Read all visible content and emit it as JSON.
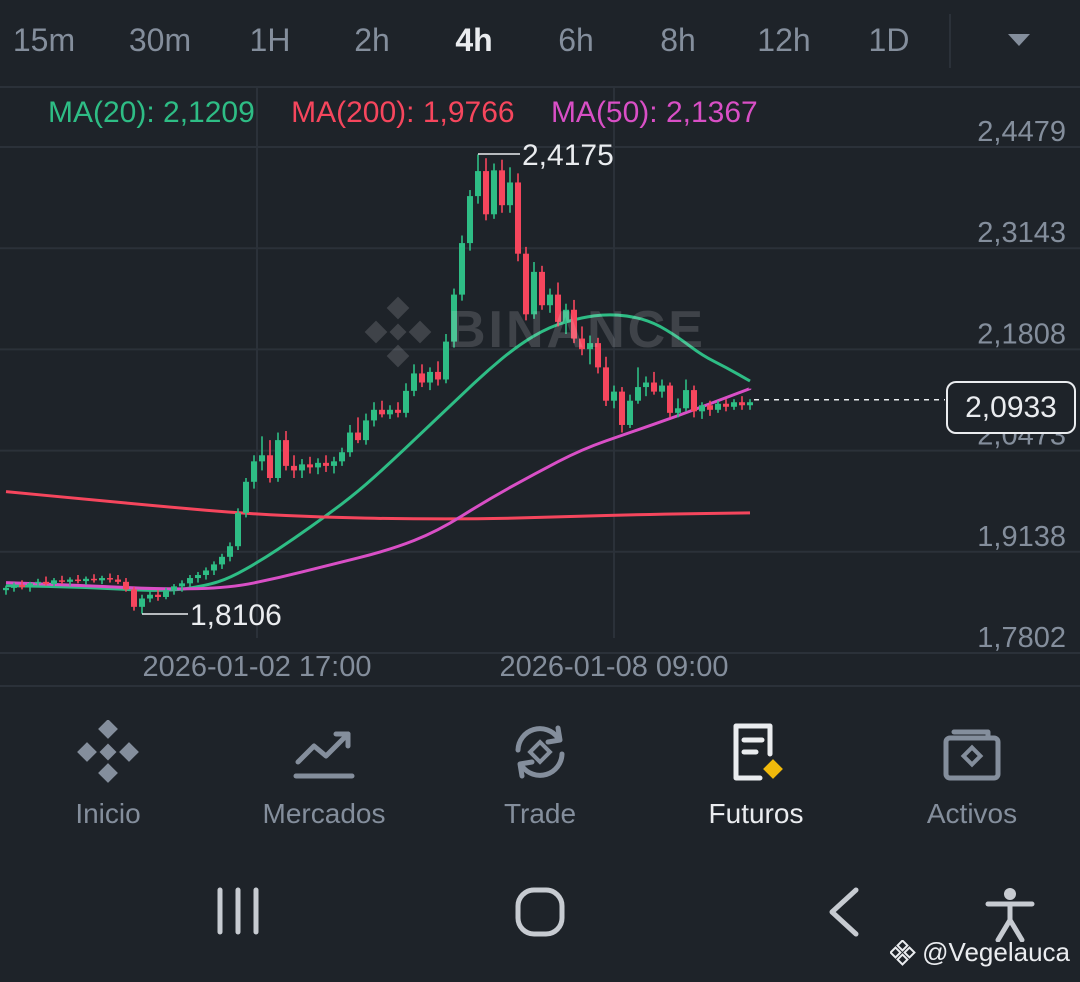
{
  "timeframes": {
    "items": [
      "15m",
      "30m",
      "1H",
      "2h",
      "4h",
      "6h",
      "8h",
      "12h",
      "1D"
    ],
    "active": "4h"
  },
  "ma_legend": [
    {
      "label": "MA(20): 2,1209",
      "color": "#2ebd85"
    },
    {
      "label": "MA(200): 1,9766",
      "color": "#f6465d"
    },
    {
      "label": "MA(50): 2,1367",
      "color": "#d94fc6"
    }
  ],
  "watermark": "BINANCE",
  "chart_data": {
    "type": "candlestick",
    "y_ticks": [
      "2,4479",
      "2,3143",
      "2,1808",
      "2,0473",
      "1,9138",
      "1,7802"
    ],
    "y_tick_values": [
      2.4479,
      2.3143,
      2.1808,
      2.0473,
      1.9138,
      1.7802
    ],
    "x_ticks": [
      "2026-01-02 17:00",
      "2026-01-08 09:00"
    ],
    "ylim": [
      1.7802,
      2.4479
    ],
    "current_price": "2,0933",
    "current_price_value": 2.0933,
    "high_label": "2,4175",
    "high_value": 2.4175,
    "low_label": "1,8106",
    "low_value": 1.8106,
    "up_color": "#2ebd85",
    "down_color": "#f6465d",
    "candles": [
      [
        1.842,
        1.848,
        1.836,
        1.845
      ],
      [
        1.845,
        1.852,
        1.84,
        1.849
      ],
      [
        1.849,
        1.855,
        1.843,
        1.846
      ],
      [
        1.846,
        1.853,
        1.84,
        1.851
      ],
      [
        1.851,
        1.857,
        1.846,
        1.853
      ],
      [
        1.853,
        1.86,
        1.848,
        1.85
      ],
      [
        1.85,
        1.858,
        1.845,
        1.855
      ],
      [
        1.855,
        1.861,
        1.85,
        1.853
      ],
      [
        1.853,
        1.859,
        1.848,
        1.856
      ],
      [
        1.856,
        1.862,
        1.851,
        1.854
      ],
      [
        1.854,
        1.86,
        1.849,
        1.857
      ],
      [
        1.857,
        1.863,
        1.852,
        1.855
      ],
      [
        1.855,
        1.861,
        1.85,
        1.858
      ],
      [
        1.858,
        1.864,
        1.852,
        1.856
      ],
      [
        1.856,
        1.862,
        1.85,
        1.853
      ],
      [
        1.853,
        1.858,
        1.84,
        1.843
      ],
      [
        1.843,
        1.846,
        1.815,
        1.82
      ],
      [
        1.82,
        1.836,
        1.811,
        1.831
      ],
      [
        1.831,
        1.84,
        1.826,
        1.836
      ],
      [
        1.836,
        1.842,
        1.828,
        1.833
      ],
      [
        1.833,
        1.845,
        1.83,
        1.842
      ],
      [
        1.842,
        1.85,
        1.836,
        1.847
      ],
      [
        1.847,
        1.855,
        1.84,
        1.851
      ],
      [
        1.851,
        1.862,
        1.846,
        1.858
      ],
      [
        1.858,
        1.866,
        1.852,
        1.862
      ],
      [
        1.862,
        1.872,
        1.856,
        1.868
      ],
      [
        1.868,
        1.88,
        1.862,
        1.876
      ],
      [
        1.876,
        1.89,
        1.87,
        1.886
      ],
      [
        1.886,
        1.905,
        1.88,
        1.9
      ],
      [
        1.9,
        1.95,
        1.895,
        1.944
      ],
      [
        1.944,
        1.99,
        1.938,
        1.985
      ],
      [
        1.985,
        2.02,
        1.976,
        2.012
      ],
      [
        2.012,
        2.045,
        2.0,
        2.02
      ],
      [
        2.02,
        2.04,
        1.984,
        1.99
      ],
      [
        1.99,
        2.05,
        1.985,
        2.04
      ],
      [
        2.04,
        2.052,
        2.0,
        2.006
      ],
      [
        2.006,
        2.02,
        1.99,
        2.0
      ],
      [
        2.0,
        2.015,
        1.99,
        2.008
      ],
      [
        2.008,
        2.018,
        1.996,
        2.004
      ],
      [
        2.004,
        2.016,
        1.995,
        2.01
      ],
      [
        2.01,
        2.02,
        1.998,
        2.006
      ],
      [
        2.006,
        2.018,
        1.996,
        2.012
      ],
      [
        2.012,
        2.03,
        2.006,
        2.024
      ],
      [
        2.024,
        2.06,
        2.018,
        2.05
      ],
      [
        2.05,
        2.07,
        2.036,
        2.04
      ],
      [
        2.04,
        2.075,
        2.034,
        2.066
      ],
      [
        2.066,
        2.09,
        2.058,
        2.08
      ],
      [
        2.08,
        2.092,
        2.07,
        2.074
      ],
      [
        2.074,
        2.086,
        2.068,
        2.08
      ],
      [
        2.08,
        2.09,
        2.07,
        2.076
      ],
      [
        2.076,
        2.115,
        2.07,
        2.105
      ],
      [
        2.105,
        2.14,
        2.098,
        2.128
      ],
      [
        2.128,
        2.14,
        2.11,
        2.116
      ],
      [
        2.116,
        2.136,
        2.106,
        2.13
      ],
      [
        2.13,
        2.144,
        2.112,
        2.12
      ],
      [
        2.12,
        2.18,
        2.115,
        2.17
      ],
      [
        2.17,
        2.24,
        2.162,
        2.232
      ],
      [
        2.232,
        2.31,
        2.224,
        2.3
      ],
      [
        2.3,
        2.37,
        2.29,
        2.362
      ],
      [
        2.362,
        2.417,
        2.352,
        2.395
      ],
      [
        2.395,
        2.412,
        2.33,
        2.338
      ],
      [
        2.338,
        2.405,
        2.332,
        2.396
      ],
      [
        2.396,
        2.41,
        2.34,
        2.35
      ],
      [
        2.35,
        2.4,
        2.34,
        2.38
      ],
      [
        2.38,
        2.392,
        2.276,
        2.286
      ],
      [
        2.286,
        2.295,
        2.198,
        2.206
      ],
      [
        2.206,
        2.275,
        2.2,
        2.262
      ],
      [
        2.262,
        2.27,
        2.212,
        2.218
      ],
      [
        2.218,
        2.24,
        2.208,
        2.232
      ],
      [
        2.232,
        2.248,
        2.19,
        2.196
      ],
      [
        2.196,
        2.22,
        2.18,
        2.212
      ],
      [
        2.212,
        2.225,
        2.168,
        2.174
      ],
      [
        2.174,
        2.19,
        2.152,
        2.16
      ],
      [
        2.16,
        2.178,
        2.14,
        2.168
      ],
      [
        2.168,
        2.175,
        2.128,
        2.136
      ],
      [
        2.136,
        2.15,
        2.085,
        2.092
      ],
      [
        2.092,
        2.112,
        2.082,
        2.104
      ],
      [
        2.104,
        2.11,
        2.05,
        2.06
      ],
      [
        2.06,
        2.1,
        2.056,
        2.092
      ],
      [
        2.092,
        2.136,
        2.088,
        2.11
      ],
      [
        2.11,
        2.124,
        2.098,
        2.116
      ],
      [
        2.116,
        2.13,
        2.1,
        2.104
      ],
      [
        2.104,
        2.12,
        2.096,
        2.112
      ],
      [
        2.112,
        2.116,
        2.07,
        2.076
      ],
      [
        2.076,
        2.095,
        2.07,
        2.082
      ],
      [
        2.082,
        2.12,
        2.078,
        2.106
      ],
      [
        2.106,
        2.112,
        2.07,
        2.078
      ],
      [
        2.078,
        2.09,
        2.068,
        2.086
      ],
      [
        2.086,
        2.092,
        2.072,
        2.08
      ],
      [
        2.08,
        2.092,
        2.076,
        2.088
      ],
      [
        2.088,
        2.094,
        2.078,
        2.084
      ],
      [
        2.084,
        2.094,
        2.08,
        2.09
      ],
      [
        2.09,
        2.098,
        2.08,
        2.086
      ],
      [
        2.086,
        2.094,
        2.08,
        2.09
      ]
    ],
    "series": [
      {
        "name": "MA(20)",
        "color": "#2ebd85",
        "points": [
          [
            0,
            1.848
          ],
          [
            10,
            1.846
          ],
          [
            20,
            1.84
          ],
          [
            25,
            1.848
          ],
          [
            28,
            1.858
          ],
          [
            32,
            1.882
          ],
          [
            36,
            1.91
          ],
          [
            40,
            1.94
          ],
          [
            44,
            1.972
          ],
          [
            48,
            2.01
          ],
          [
            52,
            2.05
          ],
          [
            56,
            2.09
          ],
          [
            60,
            2.13
          ],
          [
            64,
            2.165
          ],
          [
            68,
            2.19
          ],
          [
            72,
            2.202
          ],
          [
            75,
            2.206
          ],
          [
            78,
            2.204
          ],
          [
            81,
            2.195
          ],
          [
            84,
            2.176
          ],
          [
            87,
            2.152
          ],
          [
            90,
            2.136
          ],
          [
            93,
            2.118
          ]
        ]
      },
      {
        "name": "MA(200)",
        "color": "#f6465d",
        "points": [
          [
            0,
            1.972
          ],
          [
            10,
            1.962
          ],
          [
            20,
            1.952
          ],
          [
            30,
            1.943
          ],
          [
            40,
            1.938
          ],
          [
            50,
            1.936
          ],
          [
            60,
            1.936
          ],
          [
            70,
            1.939
          ],
          [
            80,
            1.942
          ],
          [
            93,
            1.944
          ]
        ]
      },
      {
        "name": "MA(50)",
        "color": "#d94fc6",
        "points": [
          [
            0,
            1.852
          ],
          [
            10,
            1.848
          ],
          [
            20,
            1.843
          ],
          [
            28,
            1.845
          ],
          [
            34,
            1.858
          ],
          [
            40,
            1.874
          ],
          [
            48,
            1.895
          ],
          [
            54,
            1.92
          ],
          [
            60,
            1.96
          ],
          [
            66,
            1.995
          ],
          [
            72,
            2.028
          ],
          [
            78,
            2.05
          ],
          [
            84,
            2.072
          ],
          [
            90,
            2.096
          ],
          [
            93,
            2.108
          ]
        ]
      }
    ]
  },
  "bottom_nav": [
    {
      "label": "Inicio",
      "icon": "binance-logo-icon",
      "active": false
    },
    {
      "label": "Mercados",
      "icon": "chart-trend-icon",
      "active": false
    },
    {
      "label": "Trade",
      "icon": "trade-swap-icon",
      "active": false
    },
    {
      "label": "Futuros",
      "icon": "futures-doc-icon",
      "active": true
    },
    {
      "label": "Activos",
      "icon": "wallet-icon",
      "active": false
    }
  ],
  "credit": "@Vegelauca",
  "colors": {
    "bg": "#1e2329",
    "grid": "#2b3139",
    "text": "#eaecef",
    "muted": "#848e9c",
    "accent": "#f0b90b"
  }
}
